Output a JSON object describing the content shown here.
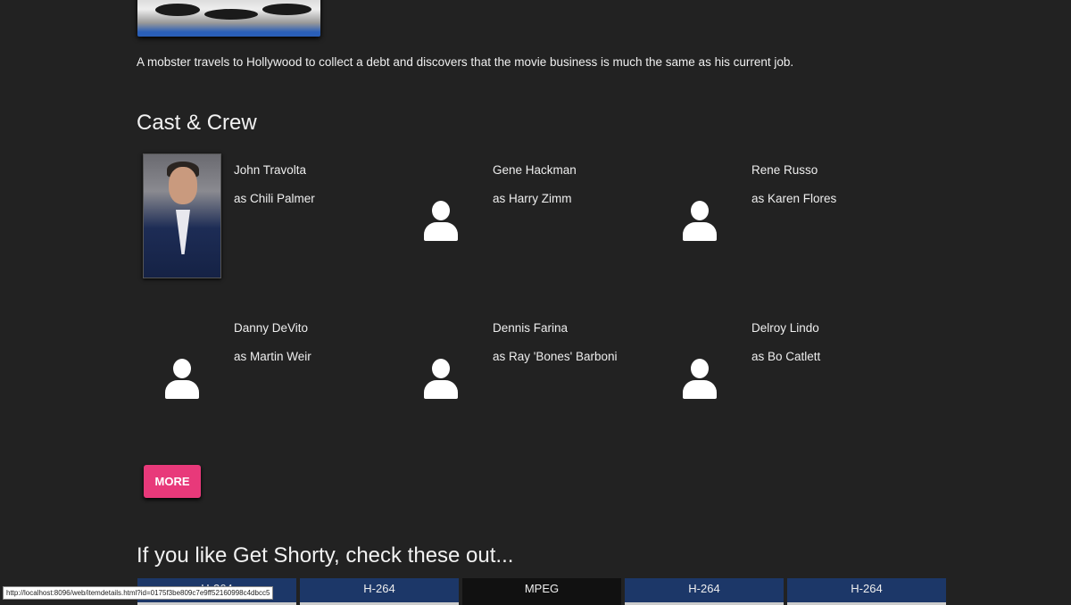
{
  "description": "A mobster travels to Hollywood to collect a debt and discovers that the movie business is much the same as his current job.",
  "cast_heading": "Cast & Crew",
  "cast": [
    {
      "name": "John Travolta",
      "role": "as Chili Palmer",
      "has_photo": true
    },
    {
      "name": "Gene Hackman",
      "role": "as Harry Zimm"
    },
    {
      "name": "Rene Russo",
      "role": "as Karen Flores"
    },
    {
      "name": "Danny DeVito",
      "role": "as Martin Weir"
    },
    {
      "name": "Dennis Farina",
      "role": "as Ray 'Bones' Barboni"
    },
    {
      "name": "Delroy Lindo",
      "role": "as Bo Catlett"
    }
  ],
  "more_label": "MORE",
  "similar_heading": "If you like Get Shorty, check these out...",
  "similar": [
    "H-264",
    "H-264",
    "MPEG",
    "H-264",
    "H-264"
  ],
  "status_url": "http://localhost:8096/web/itemdetails.html?id=0175f3be809c7e9ff52160998c4dbcc5",
  "colors": {
    "accent": "#e8397a",
    "background": "#222222",
    "tile": "#1c3768"
  }
}
